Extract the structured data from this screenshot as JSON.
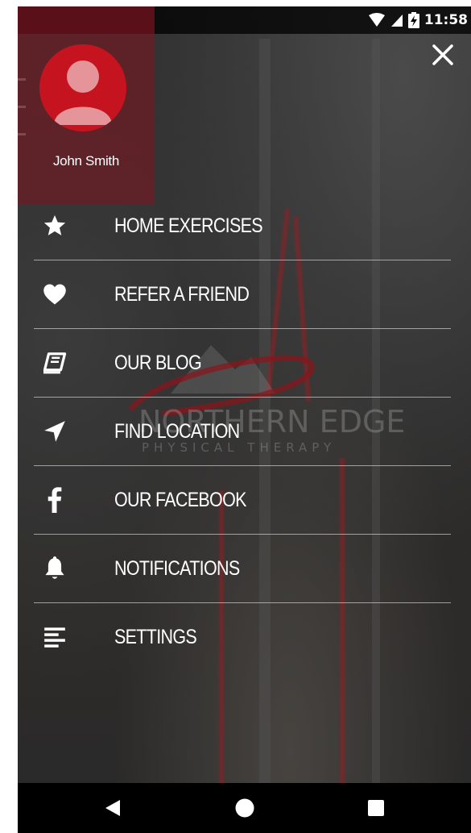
{
  "status_bar": {
    "time": "11:58",
    "icons": [
      "wifi-icon",
      "cell-signal-icon",
      "battery-charging-icon"
    ]
  },
  "profile": {
    "name": "John Smith",
    "avatar_icon": "user-avatar-icon",
    "avatar_color": "#c5141f"
  },
  "close_icon": "close-icon",
  "menu": {
    "items": [
      {
        "label": "HOME EXERCISES",
        "icon": "star-icon"
      },
      {
        "label": "REFER A FRIEND",
        "icon": "heart-icon"
      },
      {
        "label": "OUR BLOG",
        "icon": "book-icon"
      },
      {
        "label": "FIND LOCATION",
        "icon": "location-arrow-icon"
      },
      {
        "label": "OUR FACEBOOK",
        "icon": "facebook-icon"
      },
      {
        "label": "NOTIFICATIONS",
        "icon": "bell-icon"
      },
      {
        "label": "SETTINGS",
        "icon": "settings-lines-icon"
      }
    ]
  },
  "background_logo": {
    "main": "NORTHERN EDGE",
    "sub": "PHYSICAL THERAPY"
  },
  "nav_bar": {
    "buttons": [
      "back-icon",
      "home-icon",
      "recents-icon"
    ]
  },
  "colors": {
    "accent": "#c5141f",
    "overlay": "#2b2b2b",
    "text": "#ffffff"
  }
}
